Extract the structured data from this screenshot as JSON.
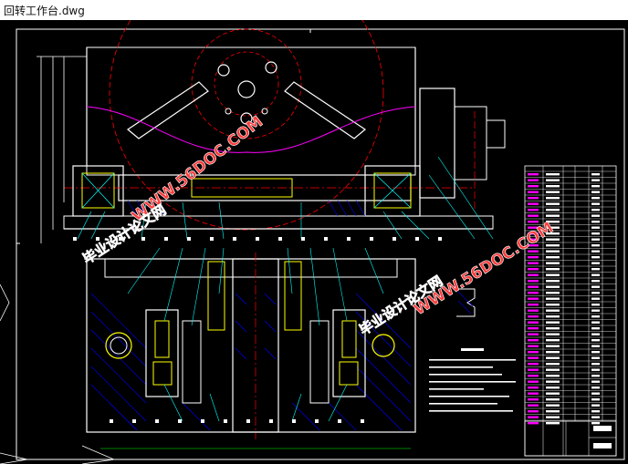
{
  "window": {
    "title": "回转工作台.dwg"
  },
  "watermarks": {
    "site": "WWW.56DOC.COM",
    "cn": "毕业设计论文网"
  },
  "colors": {
    "background": "#000000",
    "outline": "#ffffff",
    "centerline": "#ff0000",
    "part": "#ffff00",
    "leader": "#00ffff",
    "hatch": "#0000ff",
    "section": "#ff00ff",
    "dim": "#00ff00",
    "watermark_fill": "#ff3c3c",
    "watermark_stroke": "#ffffff"
  }
}
